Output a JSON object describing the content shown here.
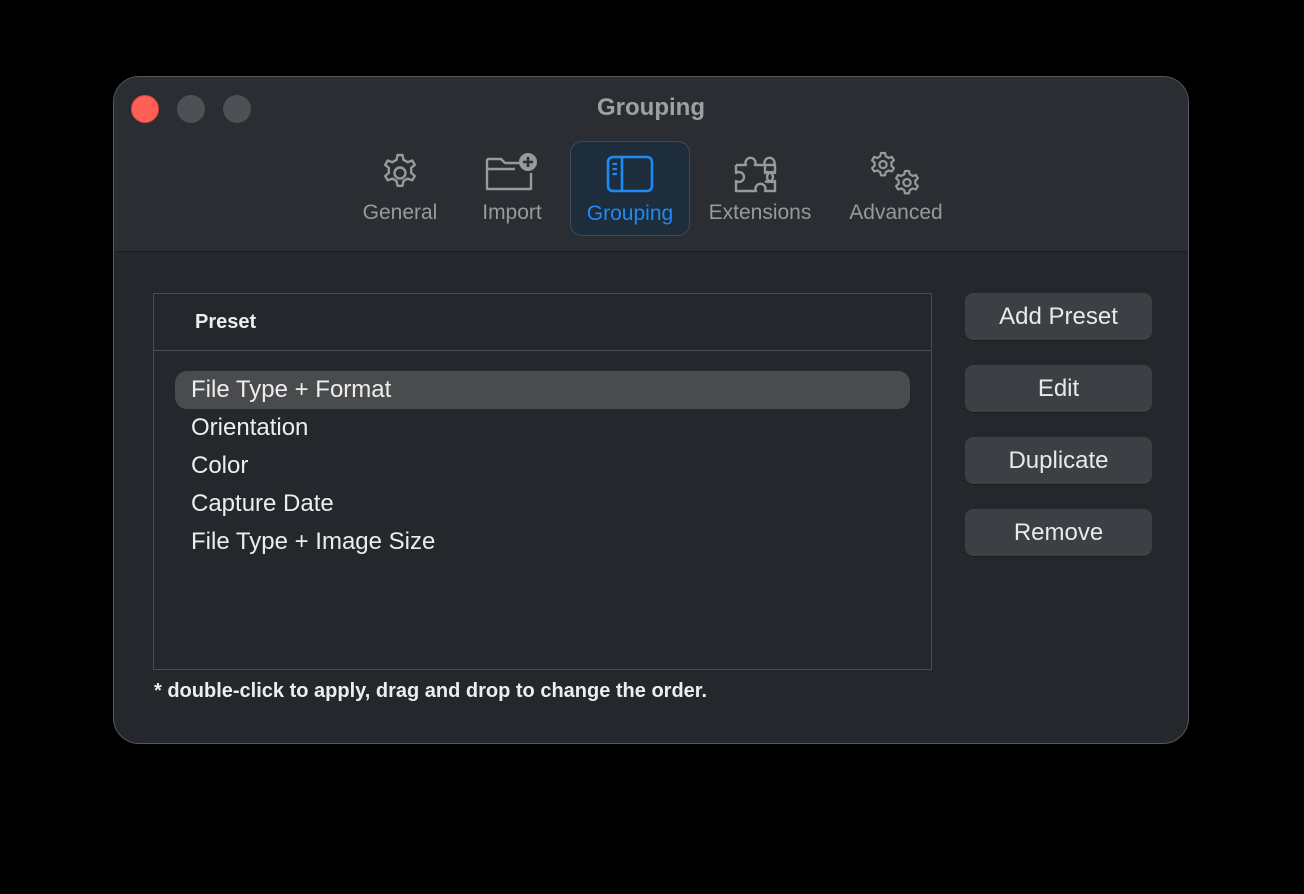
{
  "window": {
    "title": "Grouping"
  },
  "toolbar": {
    "tabs": [
      {
        "label": "General",
        "icon": "gear-icon"
      },
      {
        "label": "Import",
        "icon": "folder-plus-icon"
      },
      {
        "label": "Grouping",
        "icon": "sidebar-icon",
        "active": true
      },
      {
        "label": "Extensions",
        "icon": "puzzle-icon"
      },
      {
        "label": "Advanced",
        "icon": "gears-icon"
      }
    ]
  },
  "presets": {
    "header": "Preset",
    "items": [
      {
        "label": "File Type + Format",
        "selected": true
      },
      {
        "label": "Orientation"
      },
      {
        "label": "Color"
      },
      {
        "label": "Capture Date"
      },
      {
        "label": "File Type + Image Size"
      }
    ]
  },
  "buttons": {
    "add_preset": "Add Preset",
    "edit": "Edit",
    "duplicate": "Duplicate",
    "remove": "Remove"
  },
  "footnote": "* double-click to apply, drag and drop to change the order.",
  "colors": {
    "accent": "#1e8af5",
    "close": "#fe5f57"
  }
}
